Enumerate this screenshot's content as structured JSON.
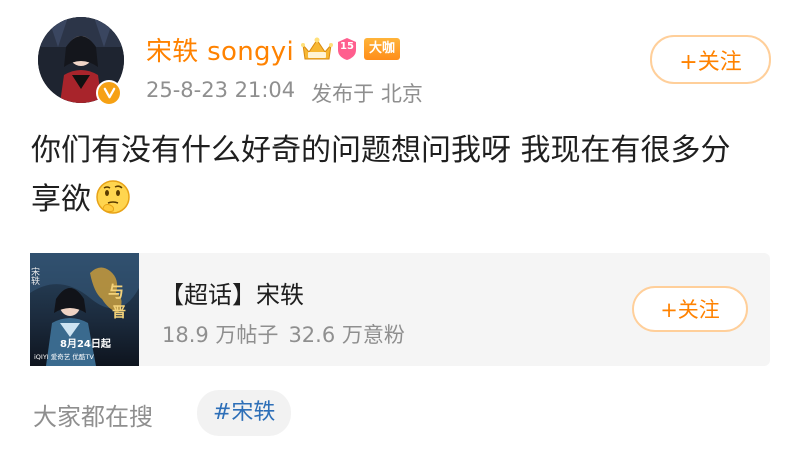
{
  "header": {
    "username": "宋轶 songyi",
    "badge_dk": "大咖",
    "level": "15",
    "timestamp": "25-8-23 21:04",
    "location": "发布于 北京",
    "follow_label": "+关注"
  },
  "post": {
    "text": "你们有没有什么好奇的问题想问我呀 我现在有很多分享欲",
    "emoji": "thinking-face-icon"
  },
  "topic_card": {
    "poster_text": {
      "date": "8月24日起",
      "brand": "iQIYI 爱奇艺  优酷TV",
      "corner": "宋轶"
    },
    "title": "【超话】宋轶",
    "posts": "18.9 万帖子",
    "fans": "32.6 万意粉",
    "follow_label": "+关注"
  },
  "trending": {
    "label": "大家都在搜",
    "tag": "#宋轶"
  },
  "colors": {
    "accent": "#ff8200",
    "muted": "#8f8f8f",
    "link": "#2d6fb8",
    "card_bg": "#f5f5f5"
  }
}
